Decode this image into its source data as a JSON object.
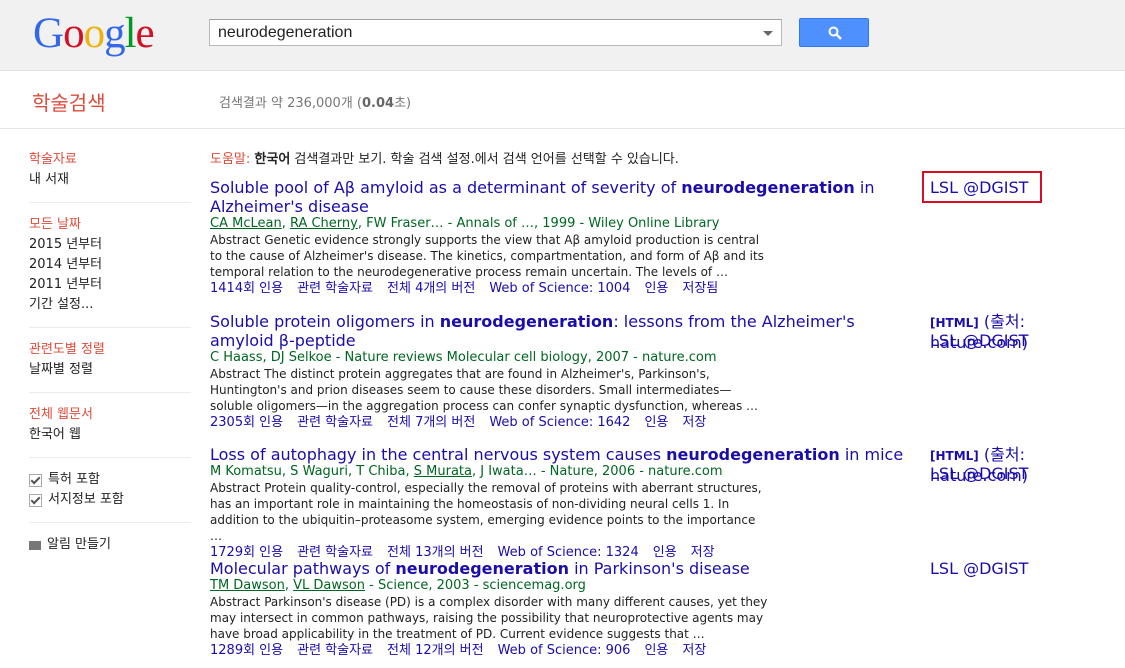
{
  "logo": {
    "text": [
      "G",
      "o",
      "o",
      "g",
      "l",
      "e"
    ]
  },
  "search": {
    "value": "neurodegeneration"
  },
  "brand": "학술검색",
  "stats": {
    "prefix": "검색결과 약 236,000개 (",
    "time": "0.04",
    "suffix": "초)"
  },
  "help": {
    "label": "도움말:",
    "lang": "한국어",
    "rest": " 검색결과만 보기. 학술 검색 설정.에서 검색 언어를 선택할 수 있습니다."
  },
  "sidebar": {
    "section1": {
      "head": "학술자료",
      "items": [
        "내 서재"
      ]
    },
    "section2": {
      "head": "모든 날짜",
      "items": [
        "2015 년부터",
        "2014 년부터",
        "2011 년부터",
        "기간 설정..."
      ]
    },
    "section3": {
      "head": "관련도별 정렬",
      "items": [
        "날짜별 정렬"
      ]
    },
    "section4": {
      "head": "전체 웹문서",
      "items": [
        "한국어 웹"
      ]
    },
    "checks": [
      "특허 포함",
      "서지정보 포함"
    ],
    "alert": "알림 만들기"
  },
  "results": [
    {
      "title_pre": "Soluble pool of Aβ amyloid as a determinant of severity of ",
      "title_bold": "neurodegeneration",
      "title_post": " in Alzheimer's disease",
      "authors_u": [
        "CA McLean",
        "RA Cherny"
      ],
      "authors_rest": ", FW Fraser… - Annals of …, 1999 - Wiley Online Library",
      "snippet": "Abstract Genetic evidence strongly supports the view that Aβ amyloid production is central to the cause of Alzheimer's disease. The kinetics, compartmentation, and form of Aβ and its temporal relation to the neurodegenerative process remain uncertain. The levels of …",
      "footer": [
        "1414회 인용",
        "관련 학술자료",
        "전체 4개의 버전",
        "Web of Science: 1004",
        "인용",
        "저장됨"
      ]
    },
    {
      "title_pre": "Soluble protein oligomers in ",
      "title_bold": "neurodegeneration",
      "title_post": ": lessons from the Alzheimer's amyloid β-peptide",
      "authors_rest": "C Haass, DJ Selkoe - Nature reviews Molecular cell biology, 2007 - nature.com",
      "snippet": "Abstract The distinct protein aggregates that are found in Alzheimer's, Parkinson's, Huntington's and prion diseases seem to cause these disorders. Small intermediates— soluble oligomers—in the aggregation process can confer synaptic dysfunction, whereas …",
      "footer": [
        "2305회 인용",
        "관련 학술자료",
        "전체 7개의 버전",
        "Web of Science: 1642",
        "인용",
        "저장"
      ]
    },
    {
      "title_pre": "Loss of autophagy in the central nervous system causes ",
      "title_bold": "neurodegeneration",
      "title_post": " in mice",
      "authors_pre": "M Komatsu, S Waguri, T Chiba, ",
      "authors_u": [
        "S Murata"
      ],
      "authors_rest": ", J Iwata… - Nature, 2006 - nature.com",
      "snippet": "Abstract Protein quality-control, especially the removal of proteins with aberrant structures, has an important role in maintaining the homeostasis of non-dividing neural cells 1. In addition to the ubiquitin–proteasome system, emerging evidence points to the importance …",
      "footer": [
        "1729회 인용",
        "관련 학술자료",
        "전체 13개의 버전",
        "Web of Science: 1324",
        "인용",
        "저장"
      ]
    },
    {
      "title_pre": "Molecular pathways of ",
      "title_bold": "neurodegeneration",
      "title_post": " in Parkinson's disease",
      "authors_u": [
        "TM Dawson",
        "VL Dawson"
      ],
      "authors_rest": " - Science, 2003 - sciencemag.org",
      "snippet": "Abstract Parkinson's disease (PD) is a complex disorder with many different causes, yet they may intersect in common pathways, raising the possibility that neuroprotective agents may have broad applicability in the treatment of PD. Current evidence suggests that …",
      "footer": [
        "1289회 인용",
        "관련 학술자료",
        "전체 12개의 버전",
        "Web of Science: 906",
        "인용",
        "저장"
      ]
    }
  ],
  "side": {
    "lsl": "LSL @DGIST",
    "html_tag": "[HTML]",
    "nature_src": "(출처: nature.com)"
  }
}
